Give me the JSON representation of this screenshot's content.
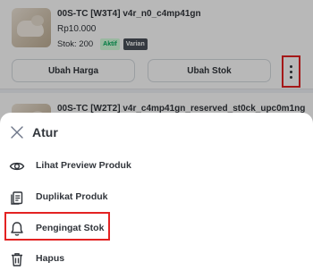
{
  "products": [
    {
      "title": "00S-TC [W3T4] v4r_n0_c4mp41gn",
      "price": "Rp10.000",
      "stock": "Stok: 200",
      "badges": {
        "active": "Aktif",
        "variant": "Varian"
      },
      "buttons": {
        "price": "Ubah Harga",
        "stock": "Ubah Stok"
      }
    },
    {
      "title": "00S-TC [W2T2] v4r_c4mp41gn_reserved_st0ck_upc0m1ng"
    }
  ],
  "sheet": {
    "title": "Atur",
    "items": [
      {
        "label": "Lihat Preview Produk",
        "icon": "eye-icon"
      },
      {
        "label": "Duplikat Produk",
        "icon": "copy-icon"
      },
      {
        "label": "Pengingat Stok",
        "icon": "bell-icon"
      },
      {
        "label": "Hapus",
        "icon": "trash-icon"
      }
    ]
  },
  "colors": {
    "highlight": "#e32222",
    "active_badge_bg": "#d6ffde",
    "active_badge_text": "#00aa5b",
    "text": "#31353b"
  }
}
